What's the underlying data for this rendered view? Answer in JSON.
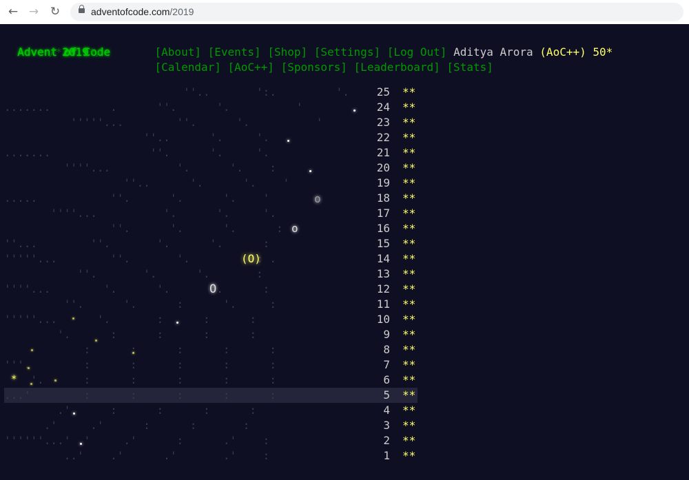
{
  "browser": {
    "back_icon": "←",
    "forward_icon": "→",
    "reload_icon": "↻",
    "url_host": "adventofcode.com",
    "url_path": "/2019"
  },
  "header": {
    "title": "Advent of Code",
    "year_prefix": "/*",
    "year": "2019",
    "year_suffix": "*/",
    "nav_row1": [
      "[About]",
      "[Events]",
      "[Shop]",
      "[Settings]",
      "[Log Out]"
    ],
    "nav_row2": [
      "[Calendar]",
      "[AoC++]",
      "[Sponsors]",
      "[Leaderboard]",
      "[Stats]"
    ],
    "user_name": "Aditya Arora",
    "aoc_plus": "(AoC++)",
    "star_count": "50*"
  },
  "calendar": {
    "days": [
      {
        "day": "25",
        "stars": "**",
        "art": "                           ''..       ':.         '."
      },
      {
        "day": "24",
        "stars": "**",
        "art": ".......         .      ''.      '.          '"
      },
      {
        "day": "23",
        "stars": "**",
        "art": "          '''''...        ''.      '.          '"
      },
      {
        "day": "22",
        "stars": "**",
        "art": "                     ''..      '.     '.   "
      },
      {
        "day": "21",
        "stars": "**",
        "art": ".......               ''.      '.     '.   "
      },
      {
        "day": "20",
        "stars": "**",
        "art": "         ''''...          '.      '.    :  "
      },
      {
        "day": "19",
        "stars": "**",
        "art": "                  ''..      '.      '.    '"
      },
      {
        "day": "18",
        "stars": "**",
        "art": ".....           ''.      '.      '.    '  "
      },
      {
        "day": "17",
        "stars": "**",
        "art": "       ''''...          '.      '.     '. "
      },
      {
        "day": "16",
        "stars": "**",
        "art": "                ''.      '.      '.      :"
      },
      {
        "day": "15",
        "stars": "**",
        "art": "''...        ''.       '.      '.      : "
      },
      {
        "day": "14",
        "stars": "**",
        "art": "'''''...        ''.       '.          : ."
      },
      {
        "day": "13",
        "stars": "**",
        "art": "           ''.       '.      '.       :  "
      },
      {
        "day": "12",
        "stars": "**",
        "art": "''''...        '.      '.      '.      : "
      },
      {
        "day": "11",
        "stars": "**",
        "art": "         ''.      '.      :      '.     : "
      },
      {
        "day": "10",
        "stars": "**",
        "art": "'''''...      '.       :      :      :   "
      },
      {
        "day": "9",
        "stars": "**",
        "art": "        '.      :      :      :      :   "
      },
      {
        "day": "8",
        "stars": "**",
        "art": "            :      :      :      :      : "
      },
      {
        "day": "7",
        "stars": "**",
        "art": "'''.        :      :      :      :      : "
      },
      {
        "day": "6",
        "stars": "**",
        "art": "    '.      :      :      :      :      : "
      },
      {
        "day": "5",
        "stars": "**",
        "art": "...'        :      :      :      :      : "
      },
      {
        "day": "4",
        "stars": "**",
        "art": "        .'      :      :      :      :   "
      },
      {
        "day": "3",
        "stars": "**",
        "art": "      .'     .'      :      :       :    "
      },
      {
        "day": "2",
        "stars": "**",
        "art": "''''''...' .'     .'      :      .'    : "
      },
      {
        "day": "1",
        "stars": "**",
        "art": "         ..'    .'      .'       .'    :"
      }
    ]
  },
  "sky": {
    "planet": "(O)",
    "orb_large": "O",
    "orb_small": "o",
    "orb_tiny": "o",
    "star_symbol": "*"
  },
  "colors": {
    "background": "#0f0f23",
    "green_bright": "#00cc00",
    "green_link": "#009900",
    "gold": "#ffff66",
    "text": "#cccccc"
  }
}
